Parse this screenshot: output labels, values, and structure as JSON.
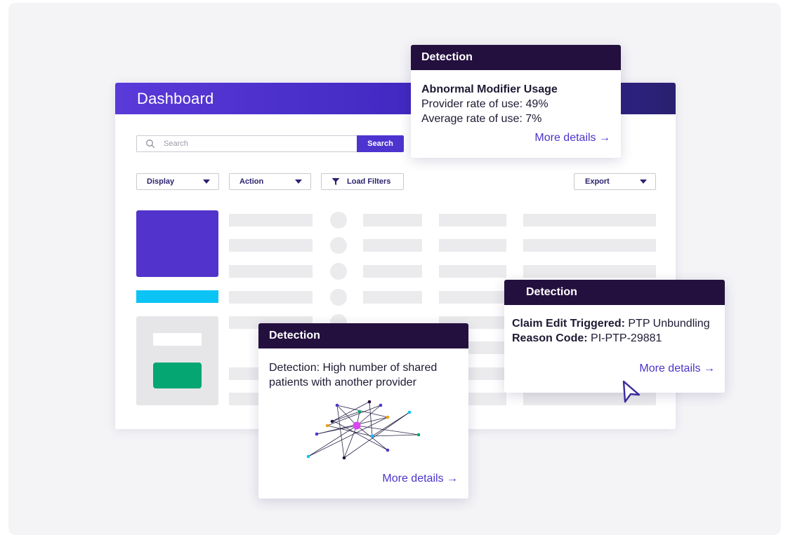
{
  "dashboard": {
    "title": "Dashboard",
    "search": {
      "placeholder": "Search",
      "button_label": "Search"
    },
    "controls": {
      "display_label": "Display",
      "action_label": "Action",
      "load_filters_label": "Load Filters",
      "export_label": "Export"
    }
  },
  "popovers": {
    "modifier": {
      "header": "Detection",
      "title": "Abnormal Modifier Usage",
      "line1": "Provider rate of use: 49%",
      "line2": "Average rate of use: 7%",
      "link": "More details →"
    },
    "claim": {
      "header": "Detection",
      "line1_label": "Claim Edit Triggered:",
      "line1_value": " PTP Unbundling",
      "line2_label": "Reason Code:",
      "line2_value": " PI-PTP-29881",
      "link": "More details →"
    },
    "shared": {
      "header": "Detection",
      "line1": "Detection: High number of shared",
      "line2": "patients with another provider",
      "link": "More details →"
    }
  },
  "colors": {
    "header_gradient_start": "#5a3ad9",
    "header_gradient_end": "#29206f",
    "accent": "#4e34cf",
    "popover_header": "#24103f",
    "cyan": "#0bc3f5",
    "green": "#05a672",
    "link": "#4a35c9"
  },
  "icons": [
    "search-icon",
    "chevron-down-icon",
    "filter-icon",
    "arrow-right-icon",
    "cursor-pointer-icon"
  ]
}
